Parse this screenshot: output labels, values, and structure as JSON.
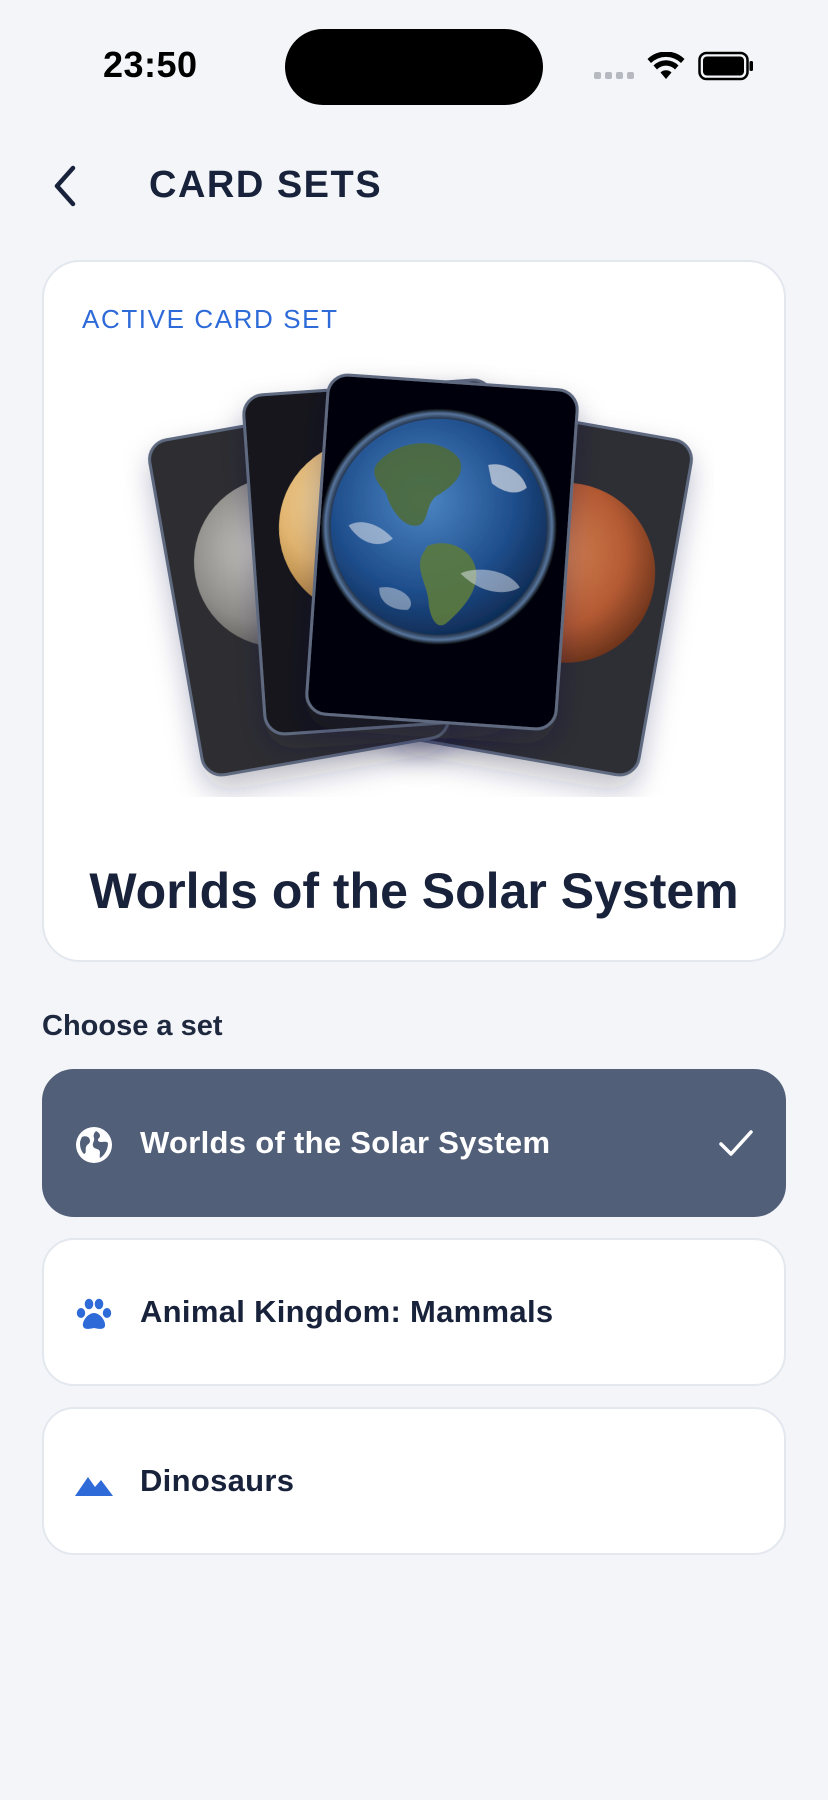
{
  "status_bar": {
    "time": "23:50"
  },
  "header": {
    "title": "CARD SETS",
    "back_icon": "chevron-left-icon"
  },
  "active_card": {
    "label": "ACTIVE CARD SET",
    "set_name": "Worlds of the Solar System",
    "cards": [
      "mercury",
      "venus",
      "earth",
      "mars"
    ]
  },
  "choose": {
    "heading": "Choose a set",
    "sets": [
      {
        "label": "Worlds of the Solar System",
        "icon": "globe-icon",
        "selected": true
      },
      {
        "label": "Animal Kingdom: Mammals",
        "icon": "paw-icon",
        "selected": false
      },
      {
        "label": "Dinosaurs",
        "icon": "mountain-icon",
        "selected": false
      }
    ]
  },
  "colors": {
    "background": "#F3F5F9",
    "accent": "#2F6BD8",
    "selected_row": "#525F79",
    "text": "#18223A"
  }
}
